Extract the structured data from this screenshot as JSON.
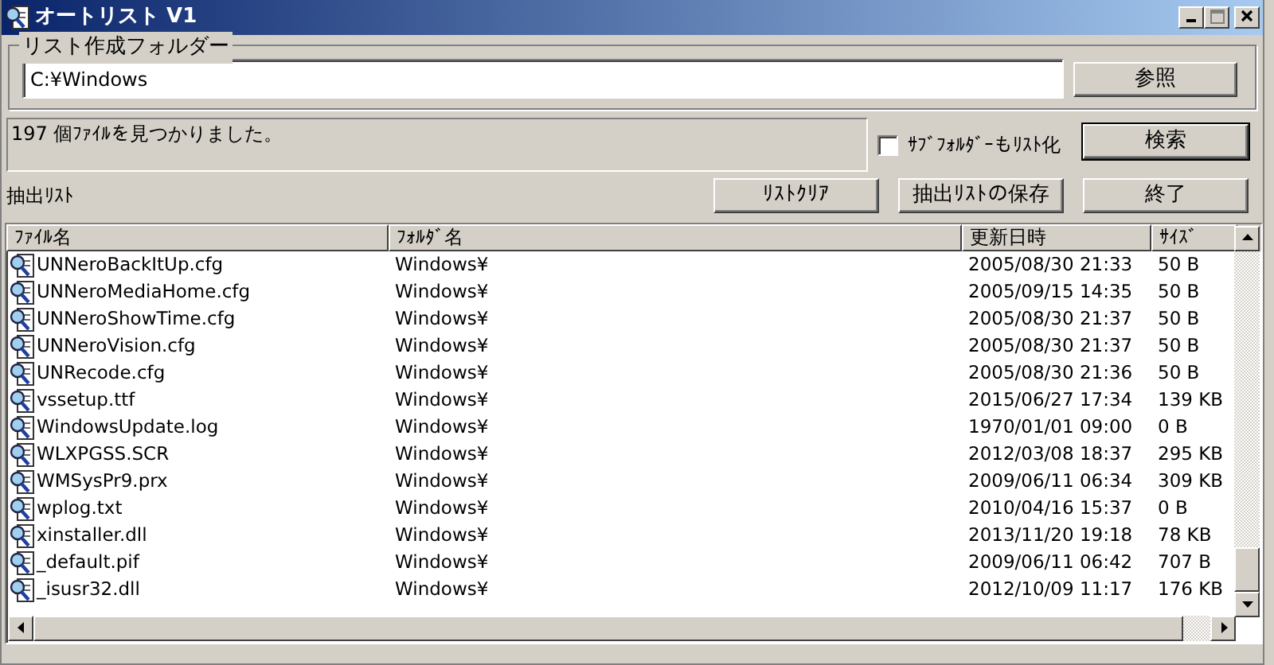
{
  "window": {
    "title": "オートリスト V1"
  },
  "folder_group": {
    "legend": "リスト作成フォルダー",
    "path_value": "C:¥Windows",
    "browse_button": "参照"
  },
  "status": {
    "message": "197 個ﾌｧｲﾙを見つかりました。"
  },
  "subfolder_checkbox": {
    "label": "ｻﾌﾞﾌｫﾙﾀﾞｰもﾘｽﾄ化",
    "checked": false
  },
  "search_button": "検索",
  "list_label": "抽出ﾘｽﾄ",
  "buttons": [
    "ﾘｽﾄｸﾘｱ",
    "抽出ﾘｽﾄの保存",
    "終了"
  ],
  "table": {
    "columns": [
      "ﾌｧｲﾙ名",
      "ﾌｫﾙﾀﾞ名",
      "更新日時",
      "ｻｲｽﾞ"
    ],
    "rows": [
      {
        "file": "UNNeroBackItUp.cfg",
        "folder": "Windows¥",
        "modified": "2005/08/30 21:33",
        "size": "50 B"
      },
      {
        "file": "UNNeroMediaHome.cfg",
        "folder": "Windows¥",
        "modified": "2005/09/15 14:35",
        "size": "50 B"
      },
      {
        "file": "UNNeroShowTime.cfg",
        "folder": "Windows¥",
        "modified": "2005/08/30 21:37",
        "size": "50 B"
      },
      {
        "file": "UNNeroVision.cfg",
        "folder": "Windows¥",
        "modified": "2005/08/30 21:37",
        "size": "50 B"
      },
      {
        "file": "UNRecode.cfg",
        "folder": "Windows¥",
        "modified": "2005/08/30 21:36",
        "size": "50 B"
      },
      {
        "file": "vssetup.ttf",
        "folder": "Windows¥",
        "modified": "2015/06/27 17:34",
        "size": "139 KB"
      },
      {
        "file": "WindowsUpdate.log",
        "folder": "Windows¥",
        "modified": "1970/01/01 09:00",
        "size": "0 B"
      },
      {
        "file": "WLXPGSS.SCR",
        "folder": "Windows¥",
        "modified": "2012/03/08 18:37",
        "size": "295 KB"
      },
      {
        "file": "WMSysPr9.prx",
        "folder": "Windows¥",
        "modified": "2009/06/11 06:34",
        "size": "309 KB"
      },
      {
        "file": "wplog.txt",
        "folder": "Windows¥",
        "modified": "2010/04/16 15:37",
        "size": "0 B"
      },
      {
        "file": "xinstaller.dll",
        "folder": "Windows¥",
        "modified": "2013/11/20 19:18",
        "size": "78 KB"
      },
      {
        "file": "_default.pif",
        "folder": "Windows¥",
        "modified": "2009/06/11 06:42",
        "size": "707 B"
      },
      {
        "file": "_isusr32.dll",
        "folder": "Windows¥",
        "modified": "2012/10/09 11:17",
        "size": "176 KB"
      }
    ]
  }
}
